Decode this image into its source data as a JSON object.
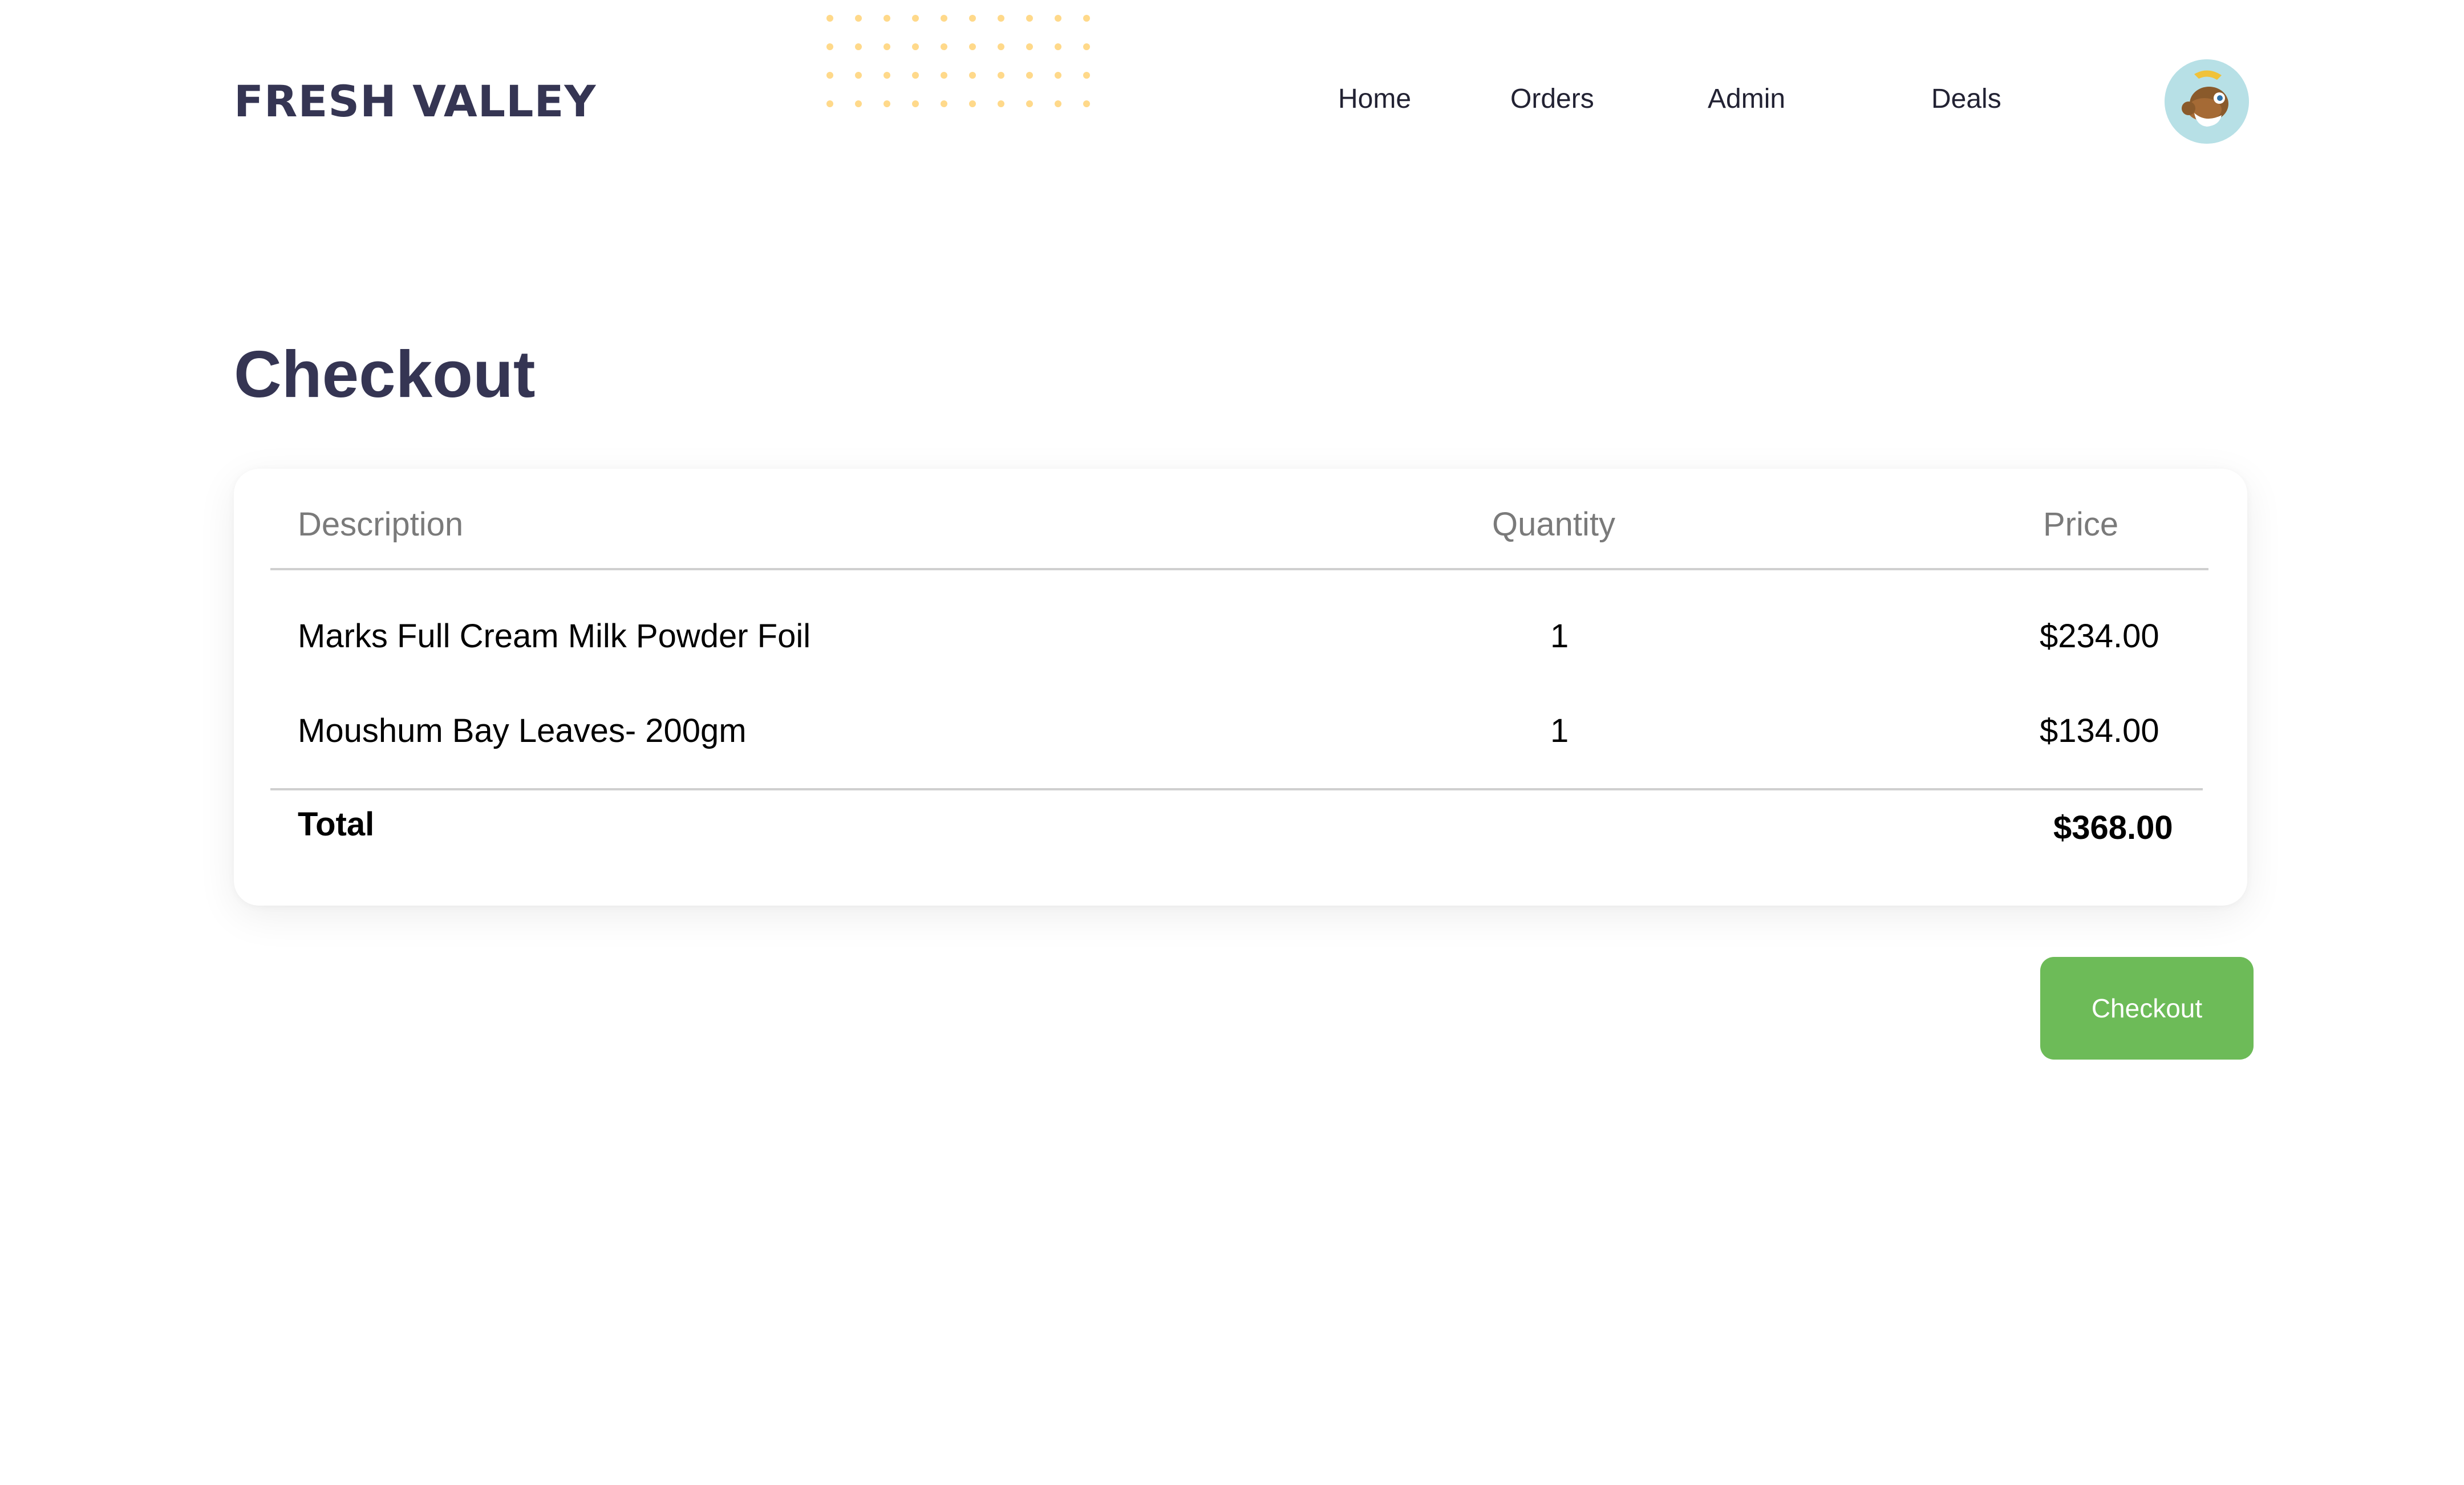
{
  "brand": {
    "name": "FRESH VALLEY"
  },
  "nav": {
    "items": [
      {
        "label": "Home"
      },
      {
        "label": "Orders"
      },
      {
        "label": "Admin"
      },
      {
        "label": "Deals"
      }
    ],
    "avatar_icon": "user-avatar-icon"
  },
  "page": {
    "title": "Checkout"
  },
  "table": {
    "headers": {
      "description": "Description",
      "quantity": "Quantity",
      "price": "Price"
    },
    "rows": [
      {
        "description": "Marks Full Cream Milk Powder Foil",
        "quantity": "1",
        "price": "$234.00"
      },
      {
        "description": "Moushum Bay Leaves- 200gm",
        "quantity": "1",
        "price": "$134.00"
      }
    ],
    "total": {
      "label": "Total",
      "value": "$368.00"
    }
  },
  "actions": {
    "checkout_label": "Checkout"
  },
  "colors": {
    "brand_navy": "#353553",
    "checkout_green": "#6dbb58",
    "dot_pattern": "#ffd98a",
    "avatar_bg": "#b7e0e6"
  }
}
